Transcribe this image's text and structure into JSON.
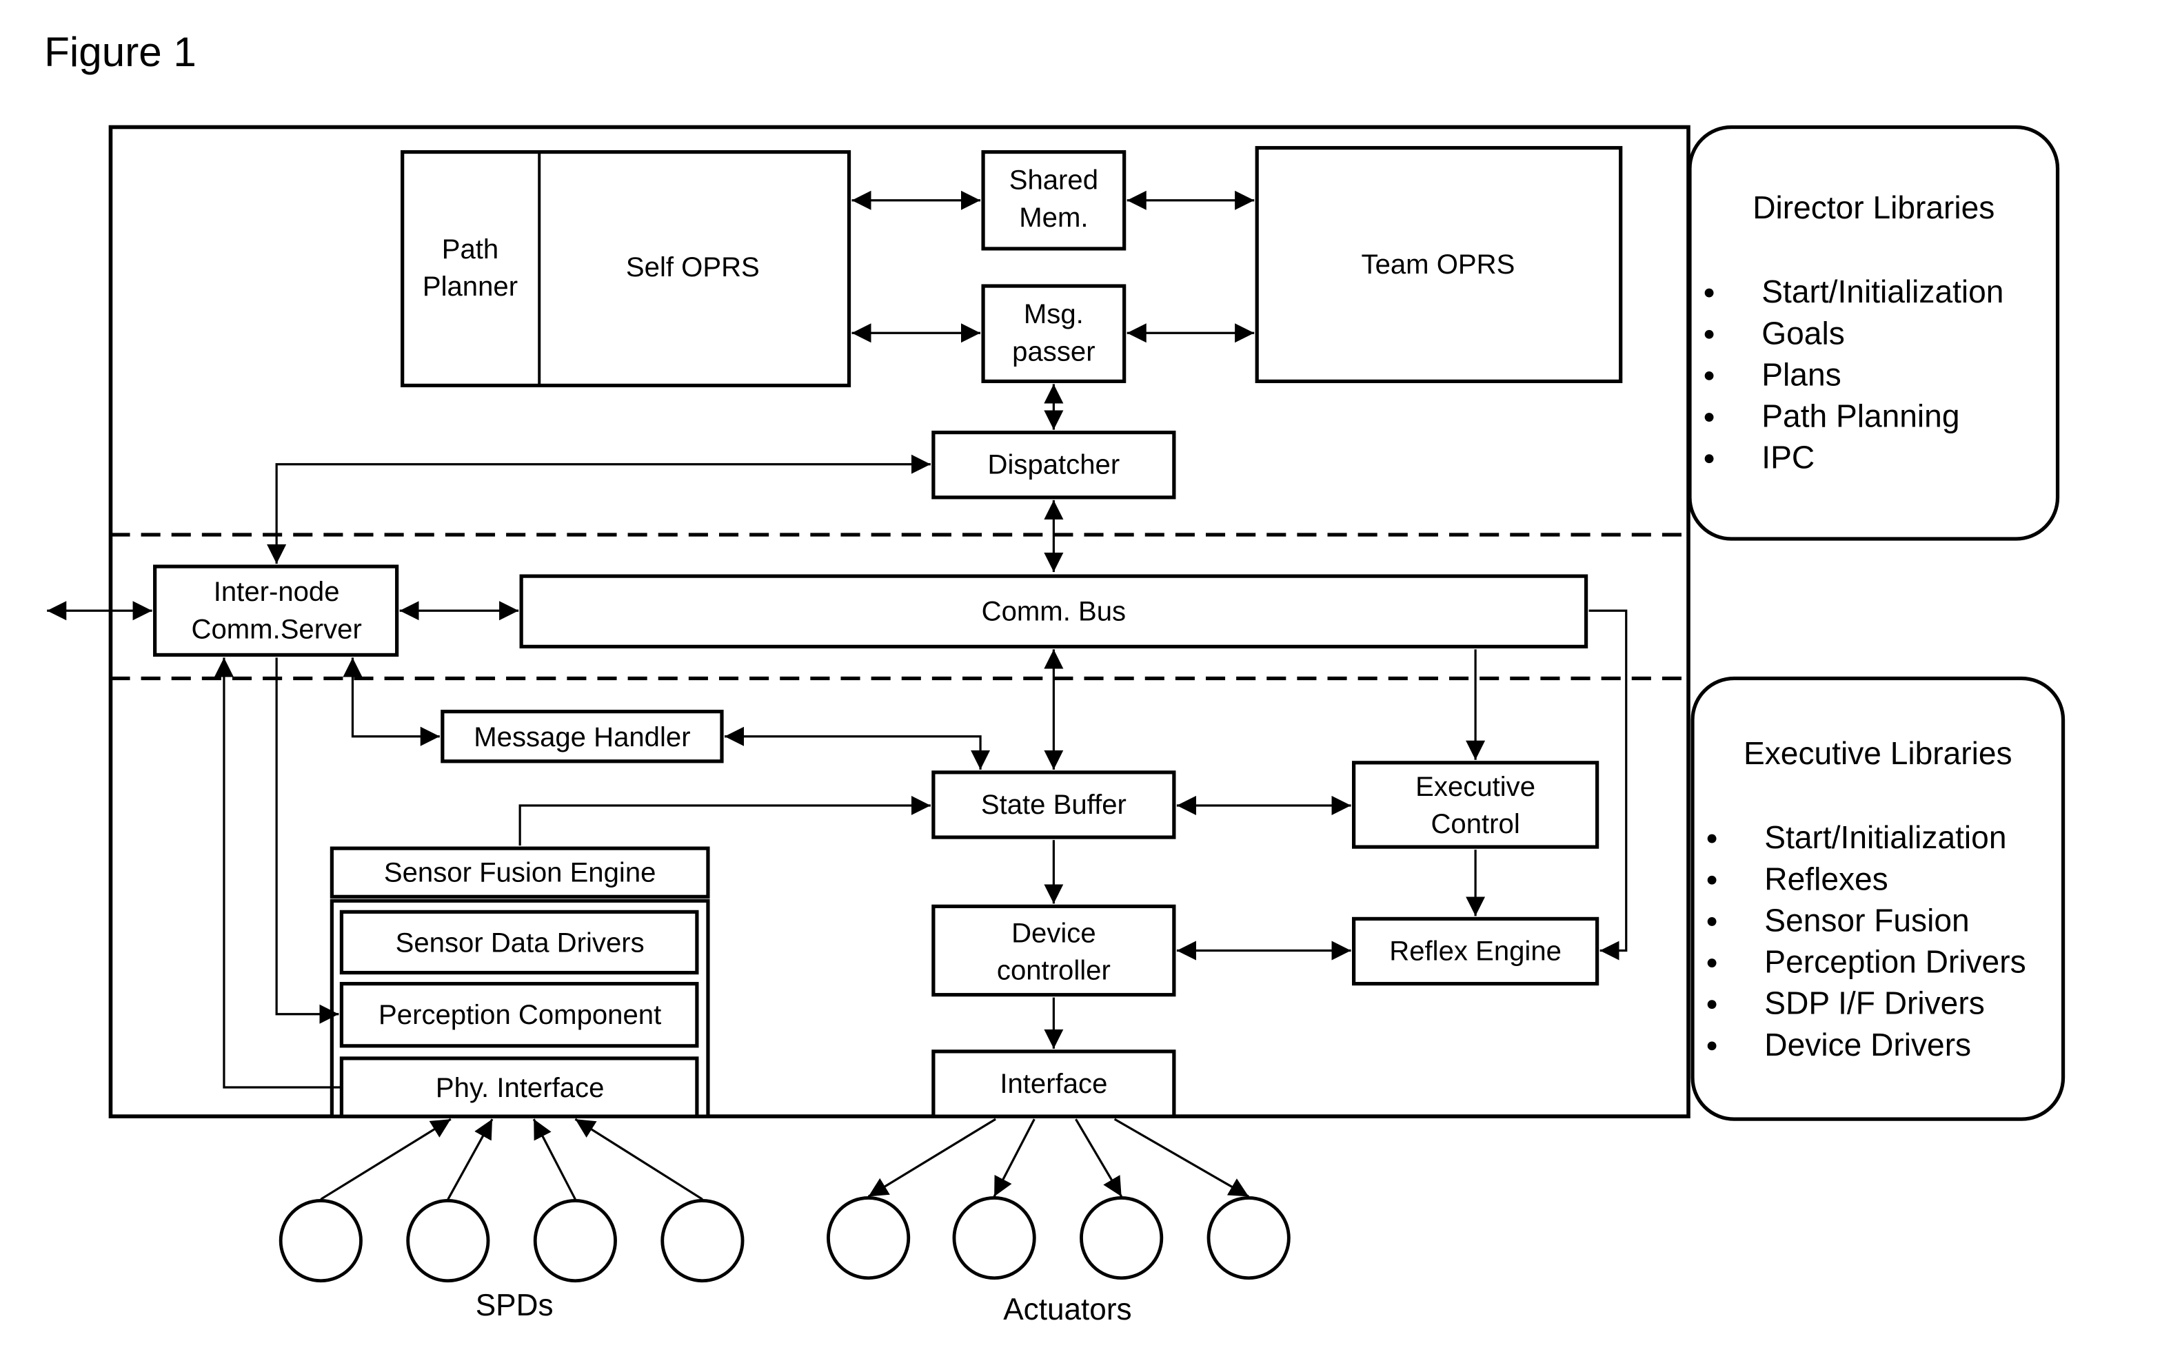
{
  "figure_title": "Figure 1",
  "director_layer": {
    "path_planner": [
      "Path",
      "Planner"
    ],
    "self_oprs": "Self OPRS",
    "shared_mem": [
      "Shared",
      "Mem."
    ],
    "msg_passer": [
      "Msg.",
      "passer"
    ],
    "team_oprs": "Team OPRS",
    "dispatcher": "Dispatcher"
  },
  "comm_layer": {
    "inter_node": [
      "Inter-node",
      "Comm.Server"
    ],
    "comm_bus": "Comm. Bus"
  },
  "executive_layer": {
    "message_handler": "Message Handler",
    "state_buffer": "State Buffer",
    "executive_control": [
      "Executive",
      "Control"
    ],
    "sensor_fusion_engine": "Sensor Fusion Engine",
    "sensor_data_drivers": "Sensor Data Drivers",
    "perception_component": "Perception Component",
    "phy_interface": "Phy. Interface",
    "device_controller": [
      "Device",
      "controller"
    ],
    "reflex_engine": "Reflex Engine",
    "interface": "Interface"
  },
  "external": {
    "spds_label": "SPDs",
    "spd_count": 4,
    "actuators_label": "Actuators",
    "actuator_count": 4
  },
  "director_libraries": {
    "title": "Director Libraries",
    "items": [
      "Start/Initialization",
      "Goals",
      "Plans",
      "Path Planning",
      "IPC"
    ]
  },
  "executive_libraries": {
    "title": "Executive Libraries",
    "items": [
      "Start/Initialization",
      "Reflexes",
      "Sensor Fusion",
      "Perception Drivers",
      "SDP I/F Drivers",
      "Device Drivers"
    ]
  }
}
